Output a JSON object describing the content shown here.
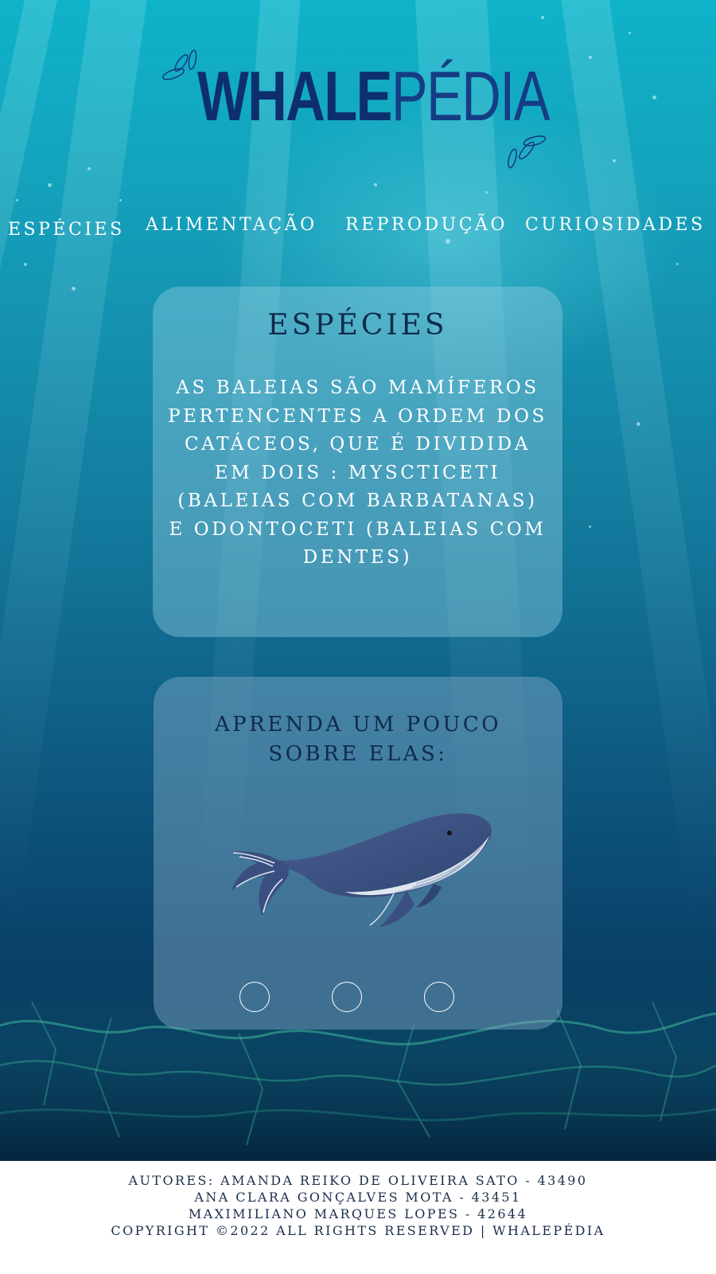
{
  "brand": {
    "logo_bold": "WHALE",
    "logo_light": "PÉDIA"
  },
  "nav": {
    "items": [
      {
        "label": "ESPÉCIES"
      },
      {
        "label": "ALIMENTAÇÃO"
      },
      {
        "label": "REPRODUÇÃO"
      },
      {
        "label": "CURIOSIDADES"
      }
    ]
  },
  "species_card": {
    "title": "ESPÉCIES",
    "body": "AS BALEIAS SÃO MAMÍFEROS PERTENCENTES A ORDEM  DOS CATÁCEOS, QUE É DIVIDIDA EM DOIS : MYSCTICETI (BALEIAS COM BARBATANAS) E ODONTOCETI (BALEIAS COM DENTES)"
  },
  "learn_card": {
    "title_line1": "APRENDA UM POUCO",
    "title_line2": "SOBRE ELAS:",
    "image": "humpback-whale-illustration",
    "carousel_dots": 3
  },
  "footer": {
    "line1": "AUTORES: AMANDA REIKO DE OLIVEIRA SATO - 43490",
    "line2": "ANA CLARA GONÇALVES MOTA - 43451",
    "line3": "MAXIMILIANO MARQUES LOPES - 42644",
    "line4": "COPYRIGHT ©2022 ALL RIGHTS RESERVED | WHALEPÉDIA"
  },
  "colors": {
    "logo": "#0d2f6e",
    "card_title": "#102a4a",
    "footer_text": "#1b2e4a",
    "ocean_top": "#0fb3c9",
    "ocean_bottom": "#062a4c"
  }
}
